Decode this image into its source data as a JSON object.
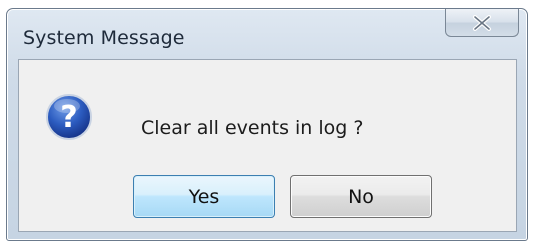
{
  "dialog": {
    "title": "System Message",
    "close_icon": "close-x-icon",
    "message_icon": "question-icon",
    "message": "Clear all events in log ?",
    "buttons": {
      "yes_label": "Yes",
      "no_label": "No"
    }
  },
  "colors": {
    "icon_blue": "#1f4fa8",
    "default_button_border": "#3c7fb1"
  }
}
